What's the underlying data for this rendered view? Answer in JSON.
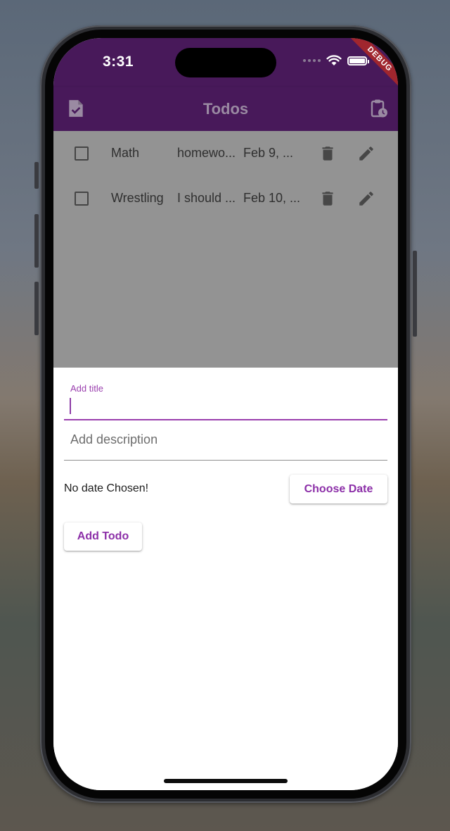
{
  "status_bar": {
    "time": "3:31",
    "debug_label": "DEBUG",
    "icons": [
      "signal-dots-icon",
      "wifi-icon",
      "battery-icon"
    ]
  },
  "app_bar": {
    "title": "Todos",
    "left_icon": "task-file-icon",
    "right_icon": "clipboard-clock-icon"
  },
  "todos": [
    {
      "title": "Math",
      "description": "homewo...",
      "date": "Feb 9, ...",
      "checked": false
    },
    {
      "title": "Wrestling",
      "description": "I should ...",
      "date": "Feb 10, ...",
      "checked": false
    }
  ],
  "form": {
    "title_label": "Add title",
    "title_value": "",
    "description_placeholder": "Add description",
    "date_status": "No date Chosen!",
    "choose_date_label": "Choose Date",
    "add_todo_label": "Add Todo"
  },
  "colors": {
    "app_bar": "#48195a",
    "accent": "#9a3fae",
    "overlay_list": "#939393",
    "debug_ribbon": "#a0262e"
  }
}
